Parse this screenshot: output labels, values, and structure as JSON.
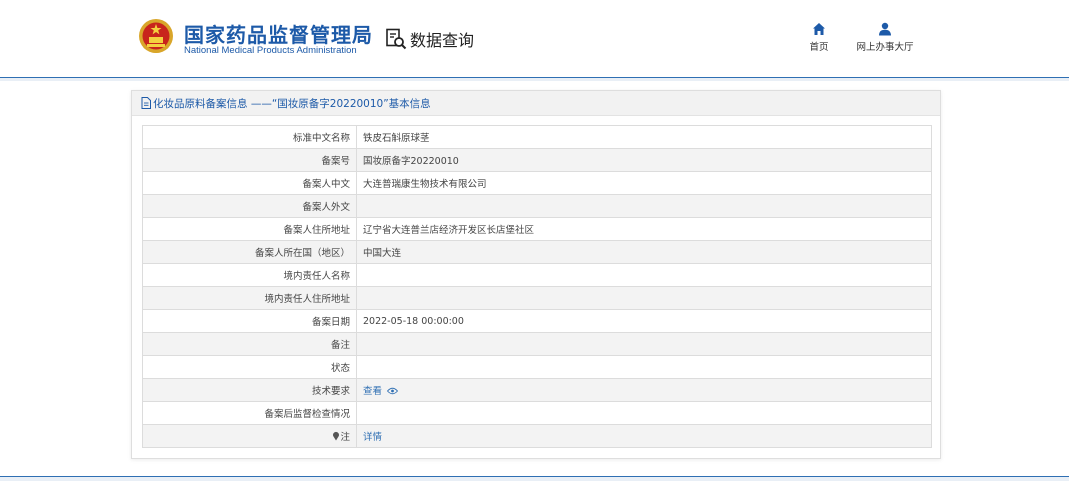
{
  "header": {
    "brand_cn": "国家药品监督管理局",
    "brand_en": "National Medical Products Administration",
    "query_label": "数据查询",
    "nav": [
      {
        "label": "首页",
        "icon": "home-icon"
      },
      {
        "label": "网上办事大厅",
        "icon": "user-icon"
      }
    ]
  },
  "panel": {
    "title": "化妆品原料备案信息 ——“国妆原备字20220010”基本信息",
    "title_icon": "document-icon"
  },
  "rows": [
    {
      "key": "标准中文名称",
      "value": "铁皮石斛原球茎"
    },
    {
      "key": "备案号",
      "value": "国妆原备字20220010"
    },
    {
      "key": "备案人中文",
      "value": "大连普瑞康生物技术有限公司"
    },
    {
      "key": "备案人外文",
      "value": ""
    },
    {
      "key": "备案人住所地址",
      "value": "辽宁省大连普兰店经济开发区长店堡社区"
    },
    {
      "key": "备案人所在国（地区）",
      "value": "中国大连"
    },
    {
      "key": "境内责任人名称",
      "value": ""
    },
    {
      "key": "境内责任人住所地址",
      "value": ""
    },
    {
      "key": "备案日期",
      "value": "2022-05-18 00:00:00"
    },
    {
      "key": "备注",
      "value": ""
    },
    {
      "key": "状态",
      "value": ""
    },
    {
      "key": "技术要求",
      "value": "查看"
    },
    {
      "key": "备案后监督检查情况",
      "value": ""
    },
    {
      "key": "注",
      "value": "详情"
    }
  ],
  "colors": {
    "brand": "#1d5aa8",
    "link": "#2f6fb3",
    "row_alt": "#f3f3f3"
  }
}
